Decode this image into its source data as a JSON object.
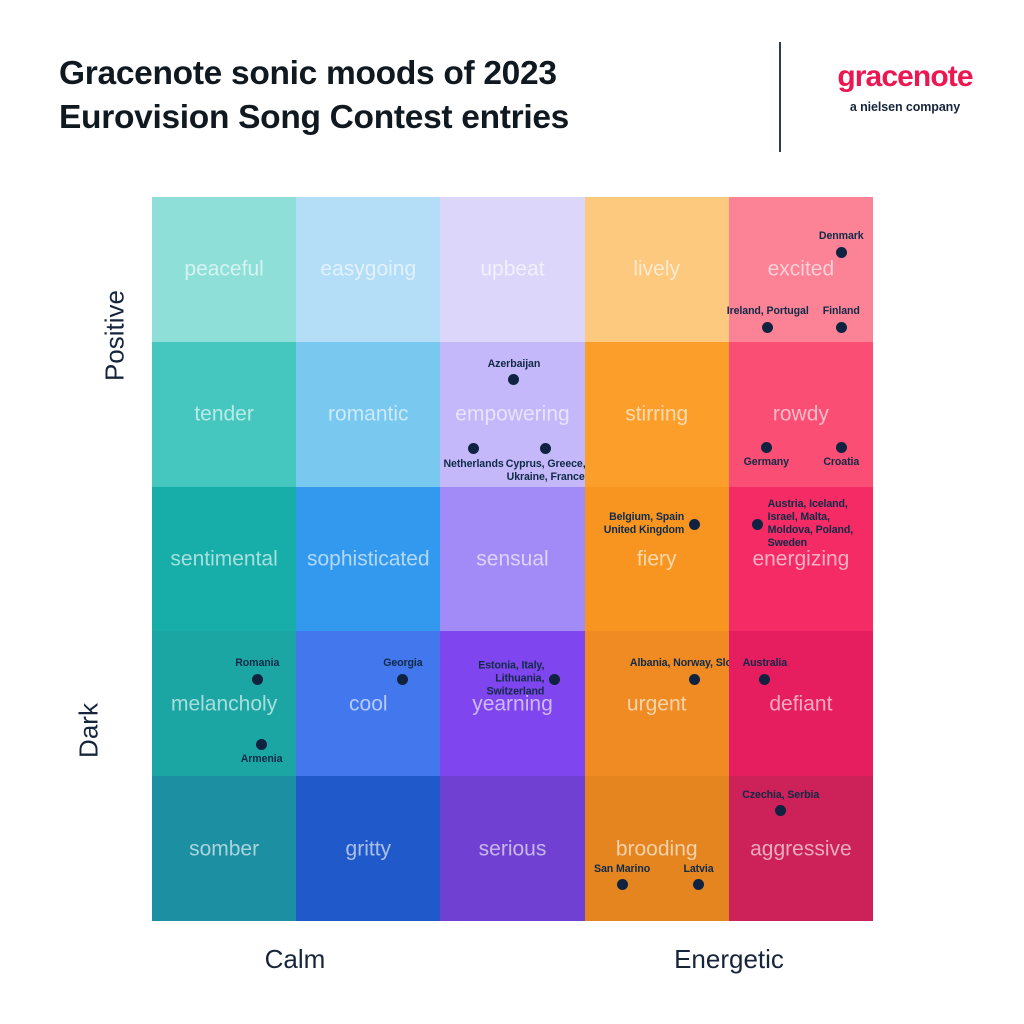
{
  "header": {
    "title_line1": "Gracenote sonic moods of 2023",
    "title_line2": "Eurovision Song Contest entries",
    "logo_word": "gracenote",
    "logo_tagline": "a nielsen company"
  },
  "axes": {
    "y_top": "Positive",
    "y_bottom": "Dark",
    "x_left": "Calm",
    "x_right": "Energetic"
  },
  "chart_data": {
    "type": "heatmap",
    "title": "Gracenote sonic moods of 2023 Eurovision Song Contest entries",
    "xlabel": "Calm ↔ Energetic",
    "ylabel": "Dark ↔ Positive",
    "grid": false,
    "legend": "none",
    "xlim": [
      0,
      5
    ],
    "ylim": [
      0,
      5
    ],
    "columns": 5,
    "rows": 5,
    "cells": [
      {
        "row": 0,
        "col": 0,
        "mood": "peaceful",
        "color": "#8fdfd9"
      },
      {
        "row": 0,
        "col": 1,
        "mood": "easygoing",
        "color": "#b4ddf8"
      },
      {
        "row": 0,
        "col": 2,
        "mood": "upbeat",
        "color": "#ddd6fb"
      },
      {
        "row": 0,
        "col": 3,
        "mood": "lively",
        "color": "#fcc97f"
      },
      {
        "row": 0,
        "col": 4,
        "mood": "excited",
        "color": "#fc8296"
      },
      {
        "row": 1,
        "col": 0,
        "mood": "tender",
        "color": "#45c7c0"
      },
      {
        "row": 1,
        "col": 1,
        "mood": "romantic",
        "color": "#79c8ef"
      },
      {
        "row": 1,
        "col": 2,
        "mood": "empowering",
        "color": "#c4b8fa"
      },
      {
        "row": 1,
        "col": 3,
        "mood": "stirring",
        "color": "#fb9e2a"
      },
      {
        "row": 1,
        "col": 4,
        "mood": "rowdy",
        "color": "#fb4e74"
      },
      {
        "row": 2,
        "col": 0,
        "mood": "sentimental",
        "color": "#17ada8"
      },
      {
        "row": 2,
        "col": 1,
        "mood": "sophisticated",
        "color": "#3399ee"
      },
      {
        "row": 2,
        "col": 2,
        "mood": "sensual",
        "color": "#a38bf7"
      },
      {
        "row": 2,
        "col": 3,
        "mood": "fiery",
        "color": "#f89520"
      },
      {
        "row": 2,
        "col": 4,
        "mood": "energizing",
        "color": "#f42b65"
      },
      {
        "row": 3,
        "col": 0,
        "mood": "melancholy",
        "color": "#1ba6a4"
      },
      {
        "row": 3,
        "col": 1,
        "mood": "cool",
        "color": "#4277ee"
      },
      {
        "row": 3,
        "col": 2,
        "mood": "yearning",
        "color": "#7f45ee"
      },
      {
        "row": 3,
        "col": 3,
        "mood": "urgent",
        "color": "#ef8b22"
      },
      {
        "row": 3,
        "col": 4,
        "mood": "defiant",
        "color": "#e61d5f"
      },
      {
        "row": 4,
        "col": 0,
        "mood": "somber",
        "color": "#1c8fa3"
      },
      {
        "row": 4,
        "col": 1,
        "mood": "gritty",
        "color": "#2059c9"
      },
      {
        "row": 4,
        "col": 2,
        "mood": "serious",
        "color": "#6f40d1"
      },
      {
        "row": 4,
        "col": 3,
        "mood": "brooding",
        "color": "#e4851f"
      },
      {
        "row": 4,
        "col": 4,
        "mood": "aggressive",
        "color": "#cc2159"
      }
    ],
    "points": [
      {
        "label": "Denmark",
        "mood": "excited",
        "row": 0,
        "col": 4,
        "x": 78,
        "y": 38,
        "pos": "above"
      },
      {
        "label": "Ireland, Portugal",
        "mood": "excited",
        "row": 0,
        "col": 4,
        "x": 27,
        "y": 90,
        "pos": "above"
      },
      {
        "label": "Finland",
        "mood": "excited",
        "row": 0,
        "col": 4,
        "x": 78,
        "y": 90,
        "pos": "above"
      },
      {
        "label": "Azerbaijan",
        "mood": "empowering",
        "row": 1,
        "col": 2,
        "x": 51,
        "y": 26,
        "pos": "above"
      },
      {
        "label": "Netherlands",
        "mood": "empowering",
        "row": 1,
        "col": 2,
        "x": 23,
        "y": 74,
        "pos": "below"
      },
      {
        "label": "Cyprus, Greece,\nUkraine, France",
        "mood": "empowering",
        "row": 1,
        "col": 2,
        "x": 73,
        "y": 74,
        "pos": "below"
      },
      {
        "label": "Germany",
        "mood": "rowdy",
        "row": 1,
        "col": 4,
        "x": 26,
        "y": 73,
        "pos": "below"
      },
      {
        "label": "Croatia",
        "mood": "rowdy",
        "row": 1,
        "col": 4,
        "x": 78,
        "y": 73,
        "pos": "below"
      },
      {
        "label": "Belgium, Spain\nUnited Kingdom",
        "mood": "fiery",
        "row": 2,
        "col": 3,
        "x": 76,
        "y": 26,
        "pos": "left"
      },
      {
        "label": "Austria, Iceland,\nIsrael, Malta,\nMoldova, Poland,\nSweden",
        "mood": "energizing",
        "row": 2,
        "col": 4,
        "x": 20,
        "y": 26,
        "pos": "right"
      },
      {
        "label": "Romania",
        "mood": "melancholy",
        "row": 3,
        "col": 0,
        "x": 73,
        "y": 33,
        "pos": "above"
      },
      {
        "label": "Armenia",
        "mood": "melancholy",
        "row": 3,
        "col": 0,
        "x": 76,
        "y": 78,
        "pos": "below"
      },
      {
        "label": "Georgia",
        "mood": "cool",
        "row": 3,
        "col": 1,
        "x": 74,
        "y": 33,
        "pos": "above"
      },
      {
        "label": "Estonia, Italy,\nLithuania,\nSwitzerland",
        "mood": "yearning",
        "row": 3,
        "col": 2,
        "x": 79,
        "y": 33,
        "pos": "left"
      },
      {
        "label": "Albania, Norway, Slovenia",
        "mood": "urgent",
        "row": 3,
        "col": 3,
        "x": 76,
        "y": 33,
        "pos": "above"
      },
      {
        "label": "Australia",
        "mood": "defiant",
        "row": 3,
        "col": 4,
        "x": 25,
        "y": 33,
        "pos": "above"
      },
      {
        "label": "Czechia, Serbia",
        "mood": "aggressive",
        "row": 4,
        "col": 4,
        "x": 36,
        "y": 24,
        "pos": "above"
      },
      {
        "label": "San Marino",
        "mood": "brooding",
        "row": 4,
        "col": 3,
        "x": 26,
        "y": 75,
        "pos": "above"
      },
      {
        "label": "Latvia",
        "mood": "brooding",
        "row": 4,
        "col": 3,
        "x": 79,
        "y": 75,
        "pos": "above"
      }
    ]
  }
}
